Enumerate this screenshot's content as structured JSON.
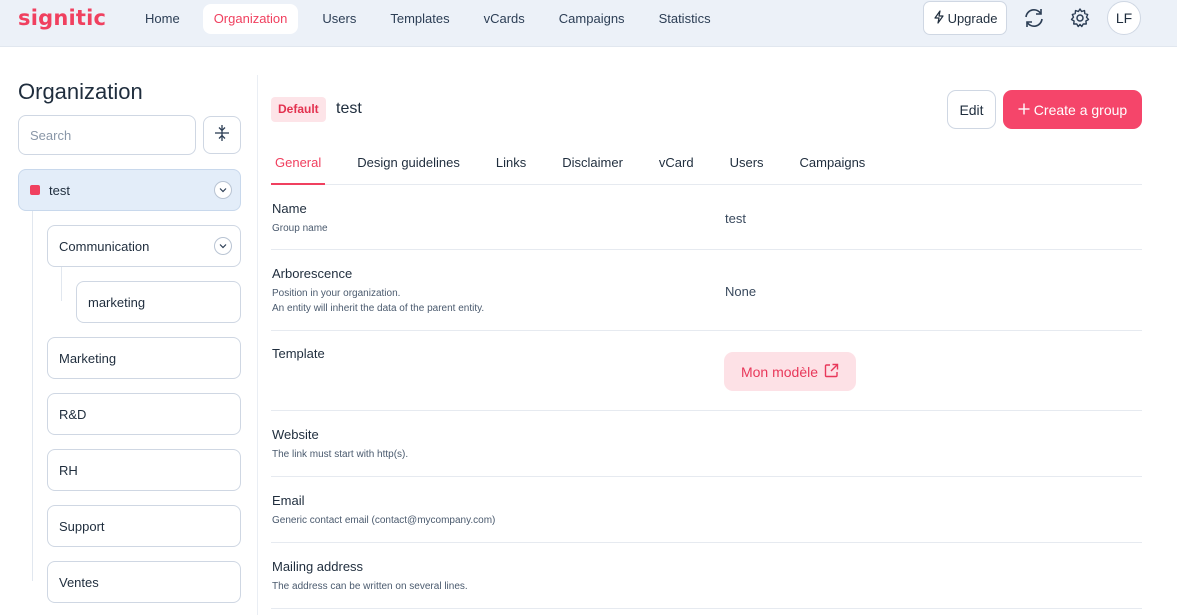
{
  "brand": {
    "logo_text": "signitic",
    "accent": "#f0405f"
  },
  "nav": {
    "items": [
      {
        "label": "Home"
      },
      {
        "label": "Organization",
        "active": true
      },
      {
        "label": "Users"
      },
      {
        "label": "Templates"
      },
      {
        "label": "vCards"
      },
      {
        "label": "Campaigns"
      },
      {
        "label": "Statistics"
      }
    ],
    "upgrade_label": "Upgrade",
    "avatar_initials": "LF"
  },
  "sidebar": {
    "title": "Organization",
    "search_placeholder": "Search",
    "tree": {
      "root": "test",
      "child": "Communication",
      "grandchild": "marketing",
      "siblings": [
        "Marketing",
        "R&D",
        "RH",
        "Support",
        "Ventes"
      ]
    }
  },
  "main": {
    "badge": "Default",
    "title": "test",
    "edit_label": "Edit",
    "create_label": "Create a group",
    "tabs": [
      "General",
      "Design guidelines",
      "Links",
      "Disclaimer",
      "vCard",
      "Users",
      "Campaigns"
    ],
    "fields": {
      "name": {
        "label": "Name",
        "desc": "Group name",
        "value": "test"
      },
      "arborescence": {
        "label": "Arborescence",
        "desc1": "Position in your organization.",
        "desc2": "An entity will inherit the data of the parent entity.",
        "value": "None"
      },
      "template": {
        "label": "Template",
        "value": "Mon modèle"
      },
      "website": {
        "label": "Website",
        "desc": "The link must start with http(s)."
      },
      "email": {
        "label": "Email",
        "desc": "Generic contact email (contact@mycompany.com)"
      },
      "mailing": {
        "label": "Mailing address",
        "desc": "The address can be written on several lines."
      }
    }
  }
}
